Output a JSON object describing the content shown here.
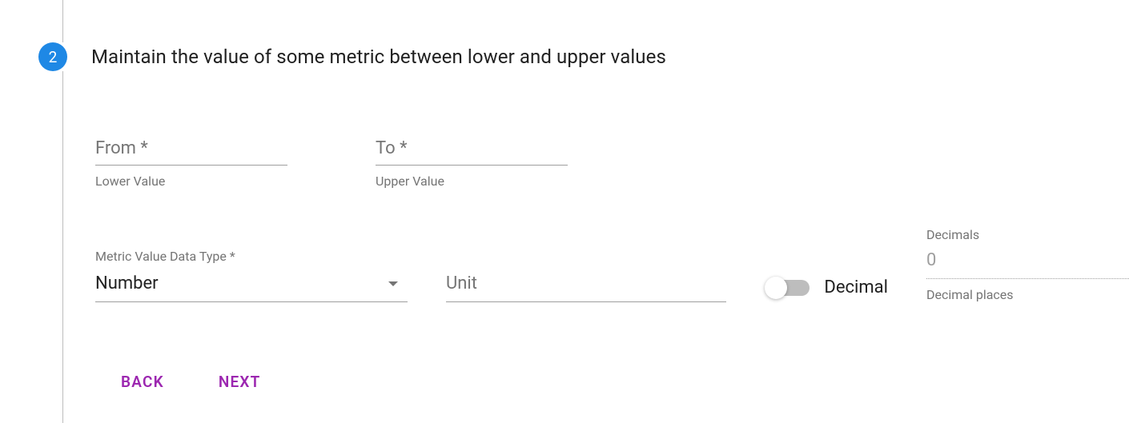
{
  "step": {
    "number": "2",
    "title": "Maintain the value of some metric between lower and upper values"
  },
  "fields": {
    "from": {
      "placeholder": "From *",
      "helper": "Lower Value"
    },
    "to": {
      "placeholder": "To *",
      "helper": "Upper Value"
    },
    "dataType": {
      "label": "Metric Value Data Type *",
      "value": "Number"
    },
    "unit": {
      "placeholder": "Unit"
    },
    "decimalToggle": {
      "label": "Decimal"
    },
    "decimals": {
      "label": "Decimals",
      "value": "0",
      "helper": "Decimal places"
    }
  },
  "buttons": {
    "back": "BACK",
    "next": "NEXT"
  }
}
